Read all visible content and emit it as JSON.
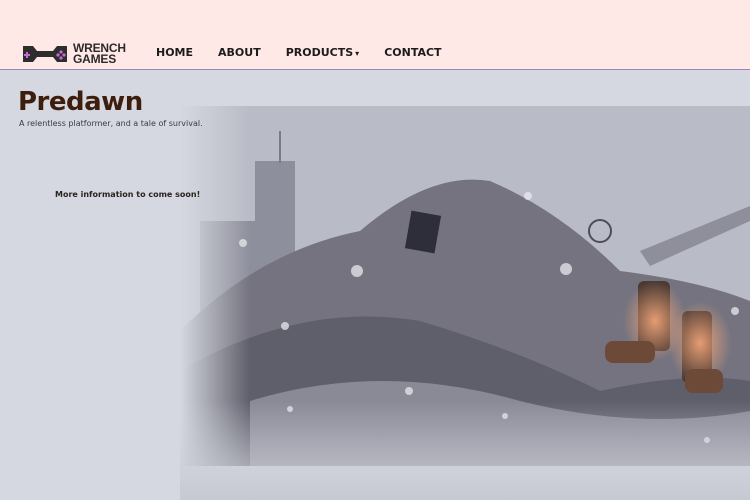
{
  "brand": {
    "line1": "WRENCH",
    "line2": "GAMES",
    "colors": {
      "gamepad": "#2d2d2d",
      "accent": "#c46bd6"
    }
  },
  "nav": {
    "items": [
      {
        "label": "HOME"
      },
      {
        "label": "ABOUT"
      },
      {
        "label": "PRODUCTS"
      },
      {
        "label": "CONTACT"
      }
    ],
    "dropdown_indicator": "▾"
  },
  "hero": {
    "title": "Predawn",
    "tagline": "A relentless platformer, and a tale of survival.",
    "info": "More information to come soon!"
  },
  "colors": {
    "header_bg": "#ffe9e6",
    "page_bg": "#d5d8e0",
    "title": "#3d1d0c",
    "header_border": "#9b86b8"
  }
}
